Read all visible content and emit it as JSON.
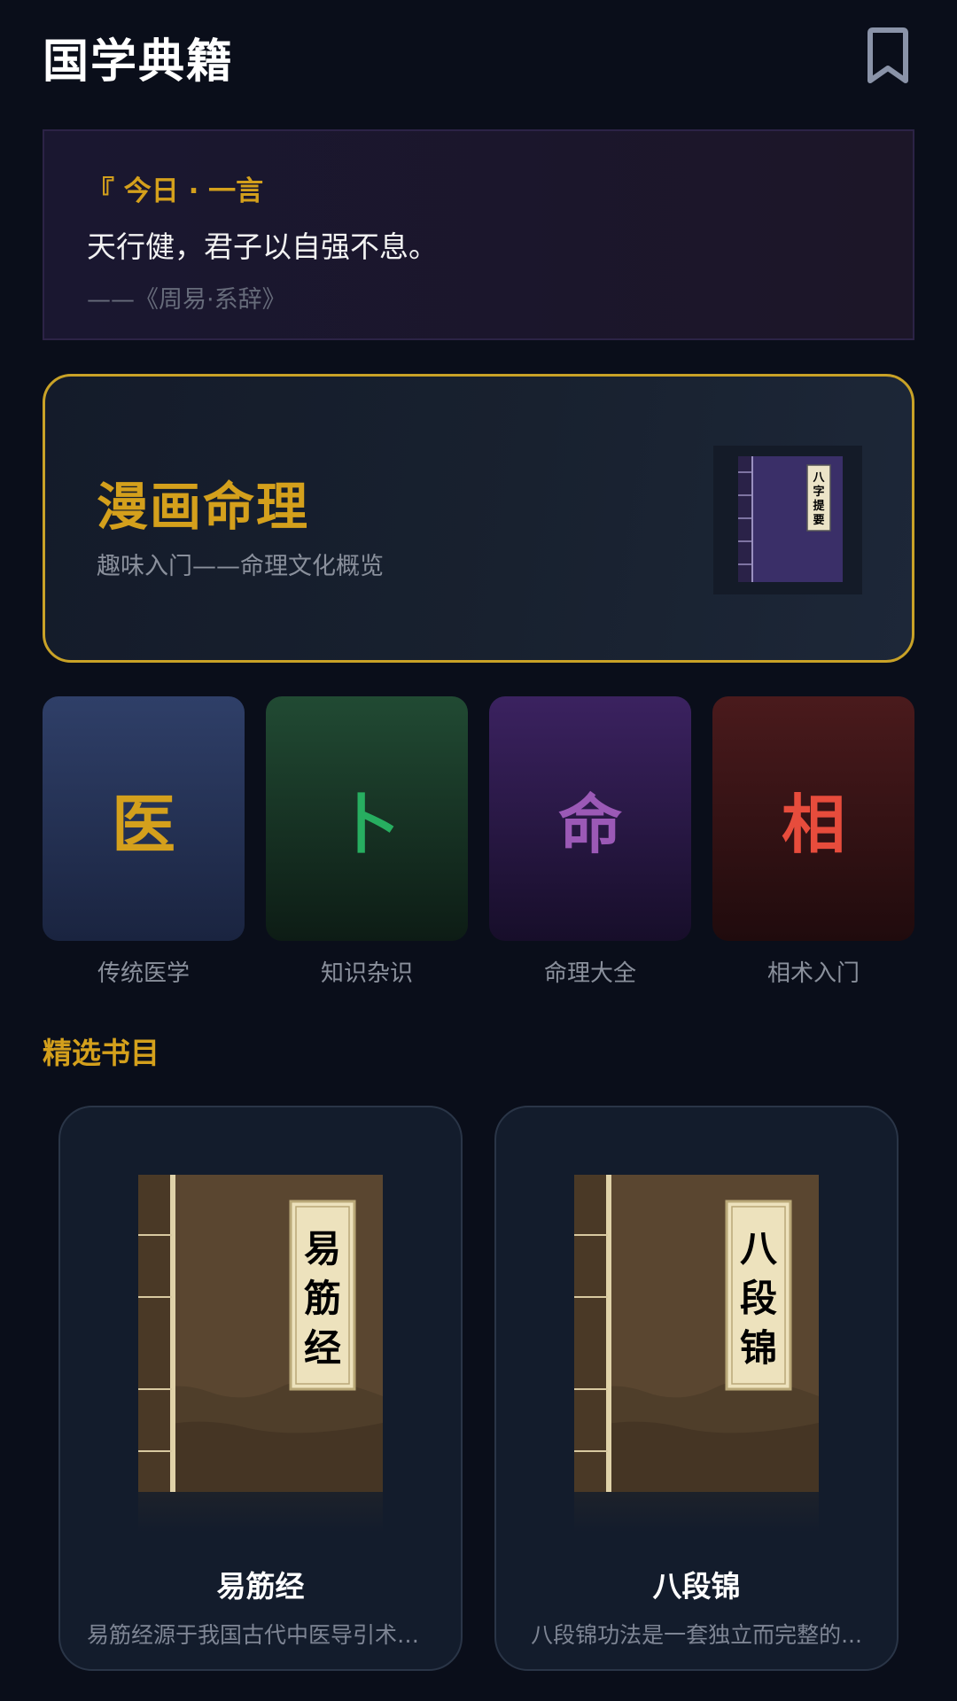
{
  "header": {
    "title": "国学典籍",
    "bookmark_icon": "bookmark-icon"
  },
  "daily_quote": {
    "label": "『 今日 · 一言",
    "text": "天行健，君子以自强不息。",
    "source": "——《周易·系辞》"
  },
  "featured": {
    "title": "漫画命理",
    "subtitle": "趣味入门——命理文化概览",
    "cover_label": "八字提要"
  },
  "categories": [
    {
      "glyph": "医",
      "label": "传统医学",
      "color": "#d4a01c"
    },
    {
      "glyph": "卜",
      "label": "知识杂识",
      "color": "#27ae60"
    },
    {
      "glyph": "命",
      "label": "命理大全",
      "color": "#9b59b6"
    },
    {
      "glyph": "相",
      "label": "相术入门",
      "color": "#e74c3c"
    }
  ],
  "section": {
    "title": "精选书目"
  },
  "books": [
    {
      "title": "易筋经",
      "cover_label": [
        "易",
        "筋",
        "经"
      ],
      "description": "易筋经源于我国古代中医导引术，..."
    },
    {
      "title": "八段锦",
      "cover_label": [
        "八",
        "段",
        "锦"
      ],
      "description": "八段锦功法是一套独立而完整的..."
    }
  ]
}
